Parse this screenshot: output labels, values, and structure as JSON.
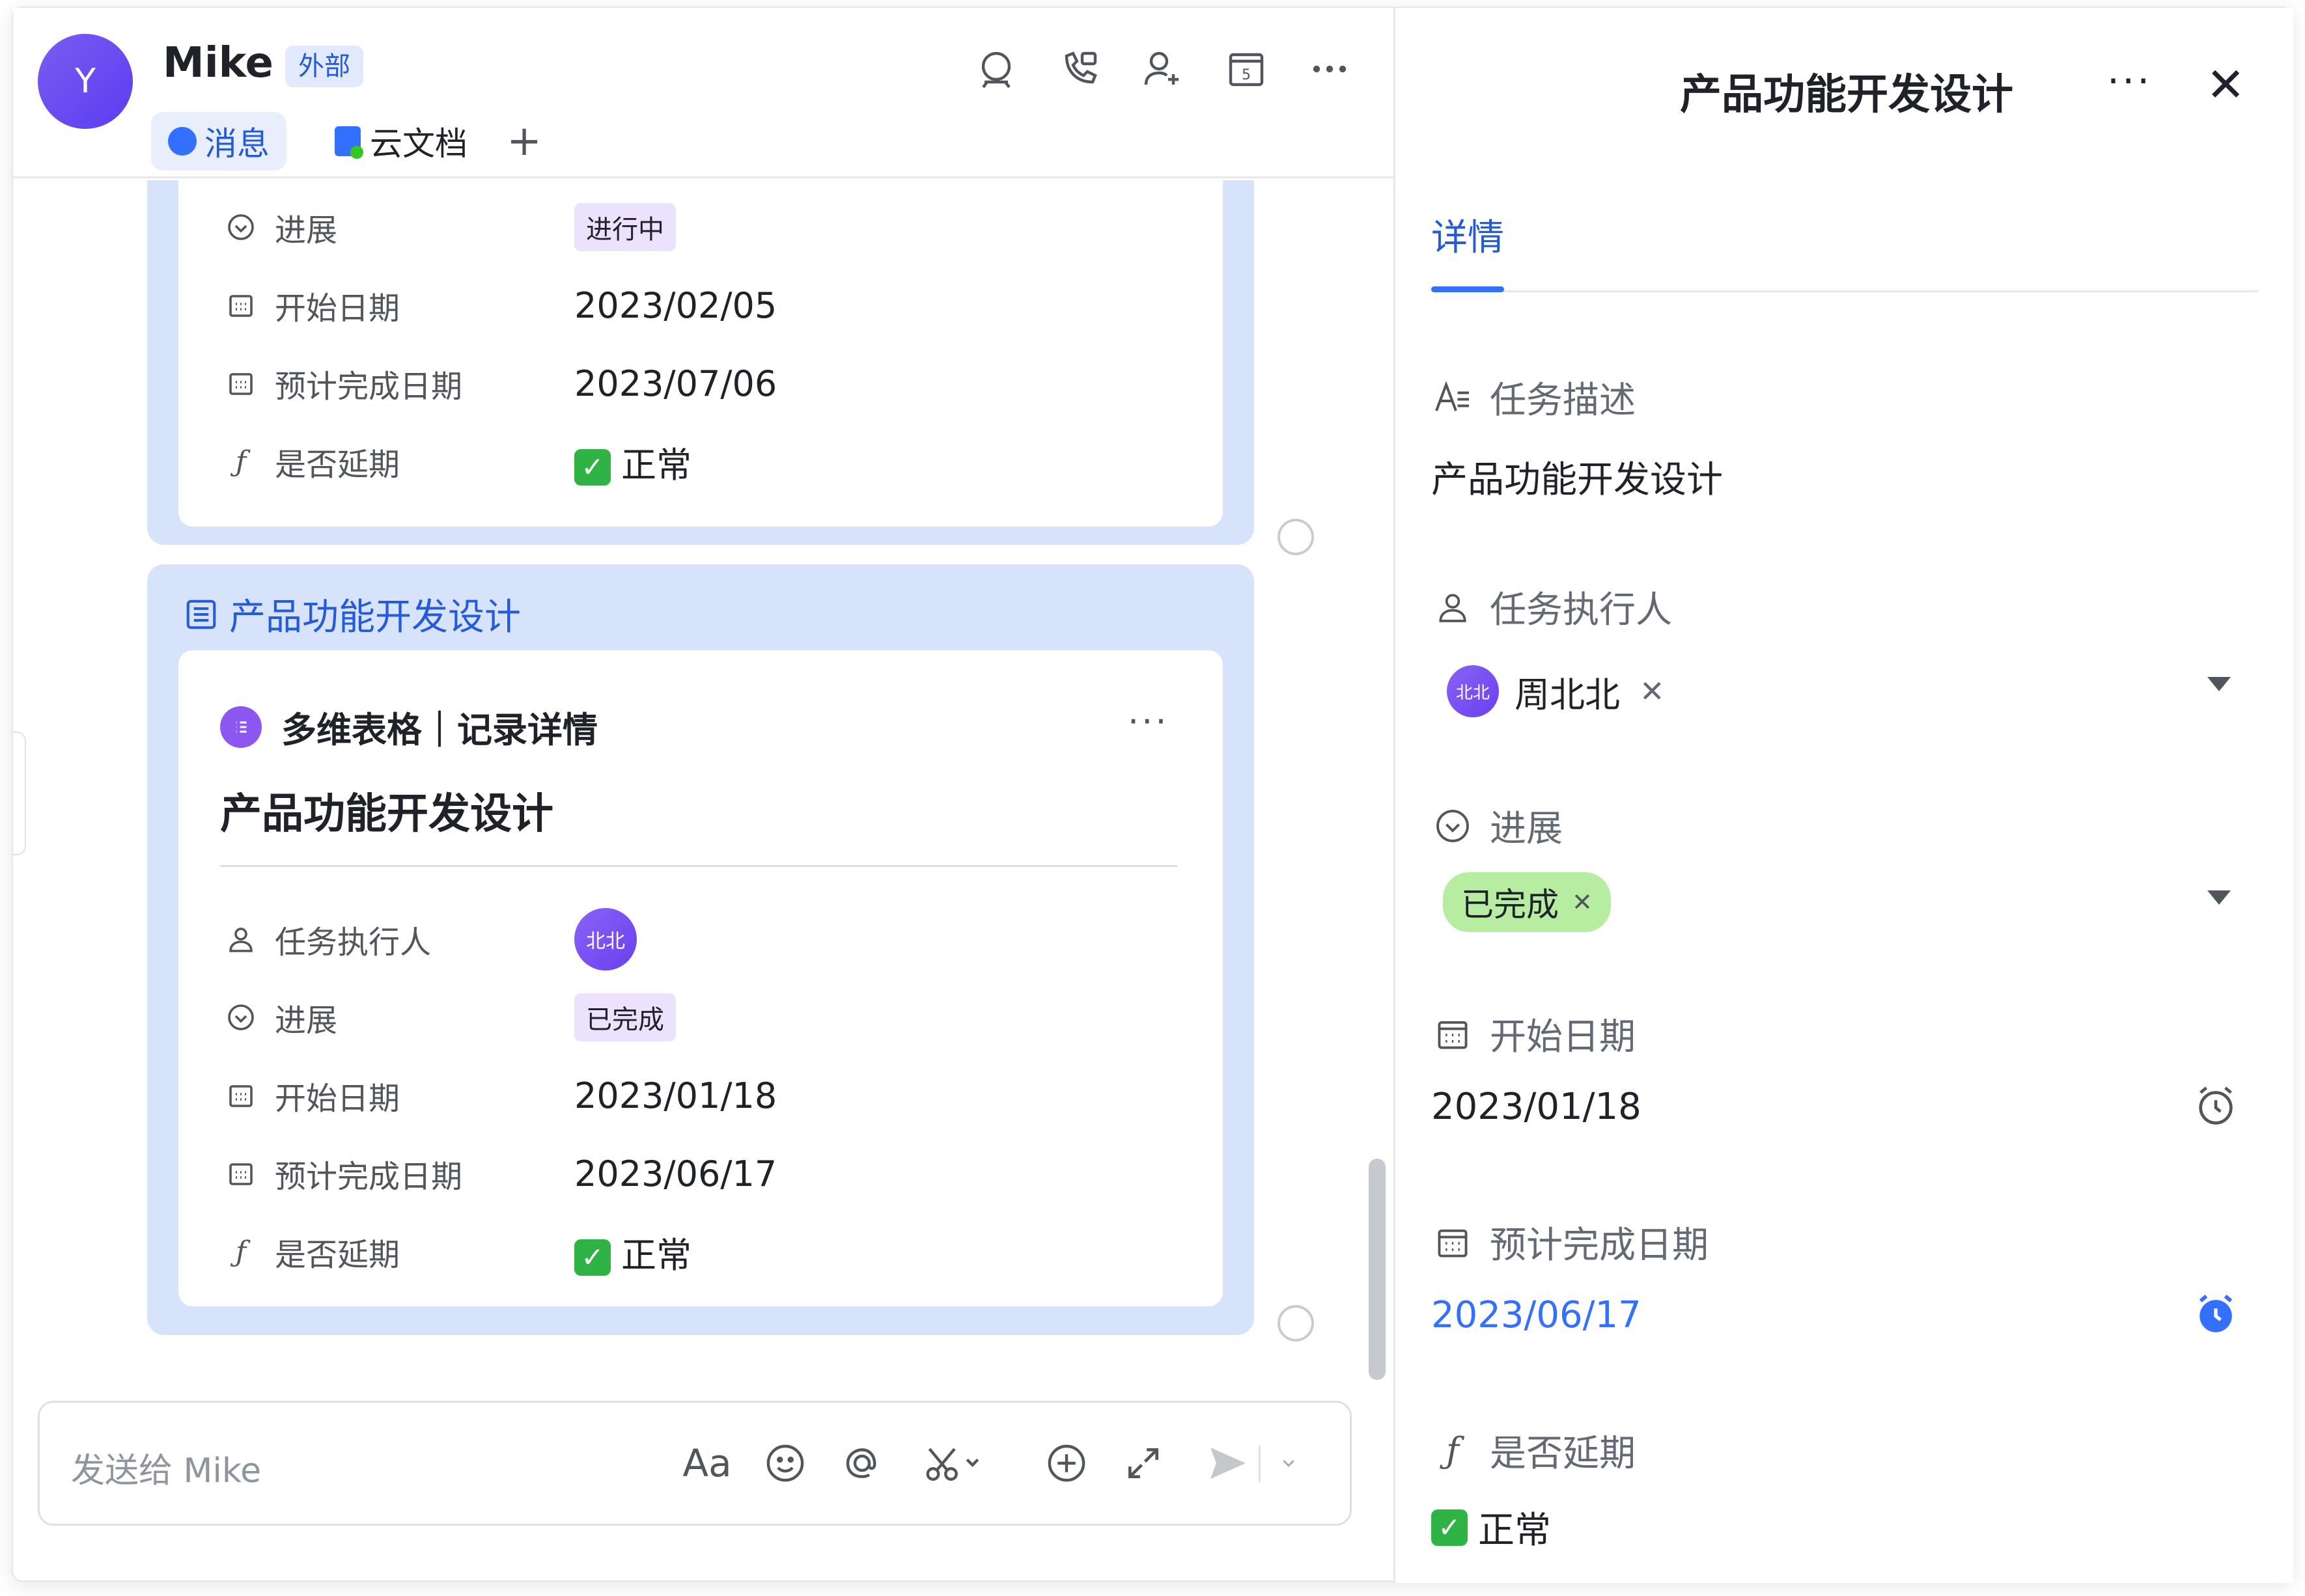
{
  "header": {
    "avatar_letter": "Y",
    "contact_name": "Mike",
    "external_badge": "外部",
    "tabs": [
      {
        "label": "消息"
      },
      {
        "label": "云文档"
      },
      {
        "label": "+"
      }
    ]
  },
  "card_top": {
    "rows": [
      {
        "label": "进展",
        "value": "进行中"
      },
      {
        "label": "开始日期",
        "value": "2023/02/05"
      },
      {
        "label": "预计完成日期",
        "value": "2023/07/06"
      },
      {
        "label": "是否延期",
        "value": "正常"
      }
    ]
  },
  "card_main": {
    "bubble_title": "产品功能开发设计",
    "source": "多维表格｜记录详情",
    "record_title": "产品功能开发设计",
    "more": "···",
    "rows": [
      {
        "label": "任务执行人",
        "value": "北北"
      },
      {
        "label": "进展",
        "value": "已完成"
      },
      {
        "label": "开始日期",
        "value": "2023/01/18"
      },
      {
        "label": "预计完成日期",
        "value": "2023/06/17"
      },
      {
        "label": "是否延期",
        "value": "正常"
      }
    ]
  },
  "input": {
    "placeholder": "发送给 Mike",
    "font_tool": "Aa"
  },
  "panel": {
    "title": "产品功能开发设计",
    "more": "···",
    "close": "✕",
    "tab": "详情",
    "fields": {
      "description_label": "任务描述",
      "description_value": "产品功能开发设计",
      "assignee_label": "任务执行人",
      "assignee_avatar": "北北",
      "assignee_name": "周北北",
      "progress_label": "进展",
      "progress_value": "已完成",
      "start_label": "开始日期",
      "start_value": "2023/01/18",
      "due_label": "预计完成日期",
      "due_value": "2023/06/17",
      "delay_label": "是否延期",
      "delay_value": "正常"
    }
  },
  "colors": {
    "accent": "#3370ff",
    "bubble": "#d6e3fb",
    "progress_tag_done": "#b7eda1",
    "progress_tag_card": "#ece2fe",
    "ok_check": "#2fb344"
  }
}
